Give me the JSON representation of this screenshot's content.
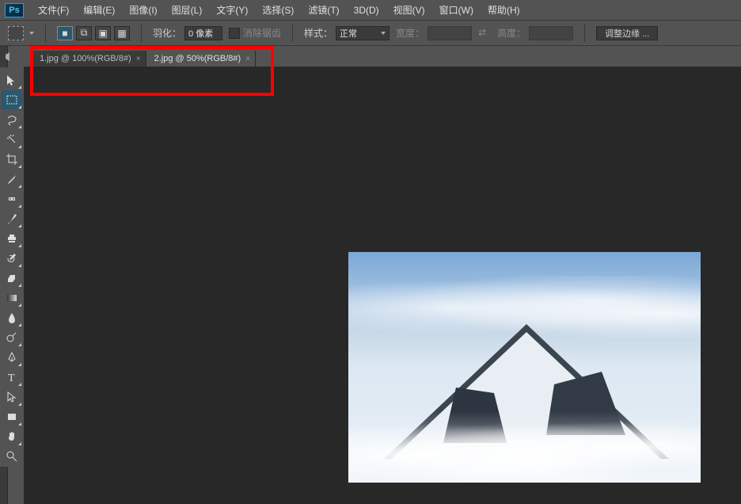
{
  "app": {
    "logo_text": "Ps"
  },
  "menu": {
    "file": "文件(F)",
    "edit": "编辑(E)",
    "image": "图像(I)",
    "layer": "图层(L)",
    "type": "文字(Y)",
    "select": "选择(S)",
    "filter": "滤镜(T)",
    "three_d": "3D(D)",
    "view": "视图(V)",
    "window": "窗口(W)",
    "help": "帮助(H)"
  },
  "options": {
    "feather_label": "羽化：",
    "feather_value": "0 像素",
    "antialias_label": "消除锯齿",
    "style_label": "样式：",
    "style_value": "正常",
    "width_label": "宽度：",
    "width_value": "",
    "height_label": "高度：",
    "height_value": "",
    "refine_edge": "调整边缘 ..."
  },
  "tabs": [
    {
      "label": "1.jpg @ 100%(RGB/8#)",
      "active": false
    },
    {
      "label": "2.jpg @ 50%(RGB/8#)",
      "active": true
    }
  ],
  "tools": {
    "move": "move-tool",
    "marquee": "rectangular-marquee-tool",
    "lasso": "lasso-tool",
    "magic_wand": "magic-wand-tool",
    "crop": "crop-tool",
    "eyedropper": "eyedropper-tool",
    "healing": "spot-healing-brush-tool",
    "brush": "brush-tool",
    "clone": "clone-stamp-tool",
    "history": "history-brush-tool",
    "eraser": "eraser-tool",
    "gradient": "gradient-tool",
    "blur": "blur-tool",
    "dodge": "dodge-tool",
    "pen": "pen-tool",
    "type": "type-tool",
    "path": "path-selection-tool",
    "rectangle": "rectangle-tool",
    "hand": "hand-tool",
    "zoom": "zoom-tool"
  }
}
